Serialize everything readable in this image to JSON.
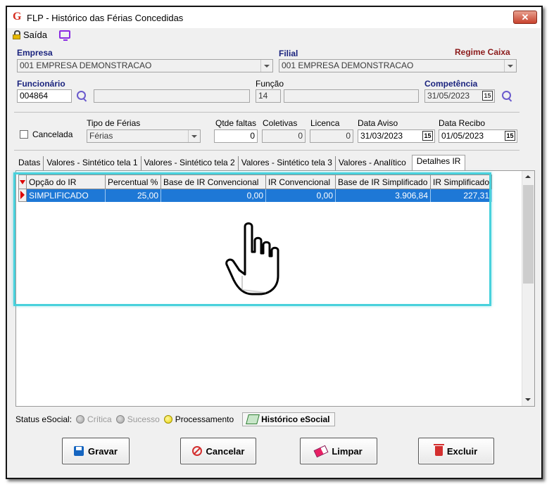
{
  "window": {
    "title": "FLP - Histórico das Férias Concedidas",
    "app_logo": "G",
    "close_symbol": "✕"
  },
  "menu": {
    "exit_label": "Saída"
  },
  "form": {
    "empresa_label": "Empresa",
    "empresa_value": "001 EMPRESA DEMONSTRACAO",
    "filial_label": "Filial",
    "filial_value": "001 EMPRESA DEMONSTRACAO",
    "regime_label": "Regime Caixa",
    "funcionario_label": "Funcionário",
    "funcionario_code": "004864",
    "funcionario_name": "",
    "funcao_label": "Função",
    "funcao_code": "14",
    "funcao_name": "",
    "competencia_label": "Competência",
    "competencia_value": "31/05/2023",
    "cancelada_label": "Cancelada",
    "tipo_ferias_label": "Tipo de Férias",
    "tipo_ferias_value": "Férias",
    "qtde_faltas_label": "Qtde faltas",
    "qtde_faltas_value": "0",
    "coletivas_label": "Coletivas",
    "coletivas_value": "0",
    "licenca_label": "Licenca",
    "licenca_value": "0",
    "data_aviso_label": "Data Aviso",
    "data_aviso_value": "31/03/2023",
    "data_recibo_label": "Data Recibo",
    "data_recibo_value": "01/05/2023",
    "calendar_glyph": "15"
  },
  "tabs": [
    {
      "label": "Datas"
    },
    {
      "label": "Valores - Sintético tela 1"
    },
    {
      "label": "Valores - Sintético tela 2"
    },
    {
      "label": "Valores - Sintético tela 3"
    },
    {
      "label": "Valores - Analítico"
    },
    {
      "label": "Detalhes IR",
      "active": true
    }
  ],
  "grid": {
    "columns": [
      "Opção do IR",
      "Percentual %",
      "Base de IR Convencional",
      "IR Convencional",
      "Base de IR Simplificado",
      "IR Simplificado"
    ],
    "rows": [
      [
        "SIMPLIFICADO",
        "25,00",
        "0,00",
        "0,00",
        "3.906,84",
        "227,31"
      ]
    ],
    "selection_color": "#1e78d6",
    "highlight_color": "#48d1dc"
  },
  "status": {
    "label": "Status eSocial:",
    "critica": "Crítica",
    "sucesso": "Sucesso",
    "processamento": "Processamento",
    "historico_button": "Histórico eSocial"
  },
  "buttons": {
    "gravar": "Gravar",
    "cancelar": "Cancelar",
    "limpar": "Limpar",
    "excluir": "Excluir"
  }
}
